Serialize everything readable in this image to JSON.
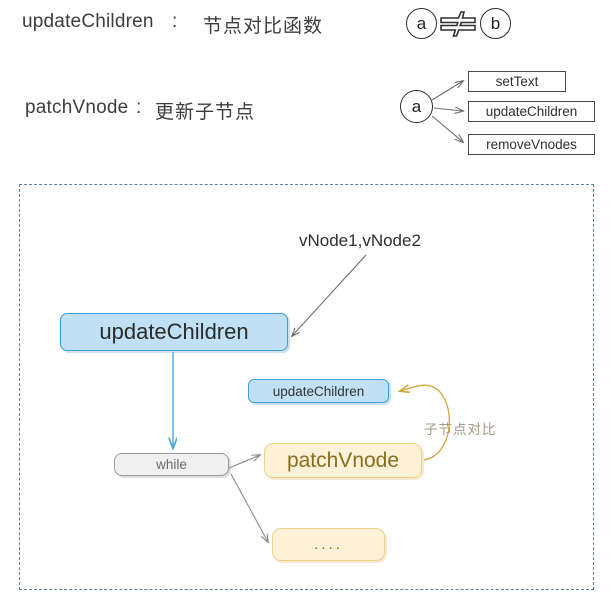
{
  "header": {
    "lines": [
      {
        "name": "updateChildren",
        "en": "updateChildren",
        "colon": ":",
        "cn": "节点对比函数"
      },
      {
        "name": "patchVnode",
        "en": "patchVnode",
        "colon": ":",
        "cn": "更新子节点"
      }
    ]
  },
  "compare_group": {
    "left_circle": "a",
    "operator": "≠",
    "right_circle": "b"
  },
  "dispatch_group": {
    "source_circle": "a",
    "targets": [
      {
        "label": "setText"
      },
      {
        "label": "updateChildren"
      },
      {
        "label": "removeVnodes"
      }
    ]
  },
  "diagram": {
    "input_label": "vNode1,vNode2",
    "annotation": "子节点对比",
    "nodes": [
      {
        "id": "update-children-main",
        "label": "updateChildren"
      },
      {
        "id": "update-children-sub",
        "label": "updateChildren"
      },
      {
        "id": "while-loop",
        "label": "while"
      },
      {
        "id": "patch-vnode",
        "label": "patchVnode"
      },
      {
        "id": "ellipsis",
        "label": "...."
      }
    ]
  },
  "colors": {
    "blue_fill": "#bfe0f5",
    "blue_border": "#3f9fd4",
    "orange_fill": "#fdf2d8",
    "orange_border": "#f0cf88",
    "grey_fill": "#f0f0f0",
    "grey_border": "#9a9a9a",
    "dashed_border": "#5b7f9e",
    "arrow_grey": "#7a7a7a",
    "arrow_orange": "#d2a63c",
    "annotation_text": "#a09a86"
  }
}
